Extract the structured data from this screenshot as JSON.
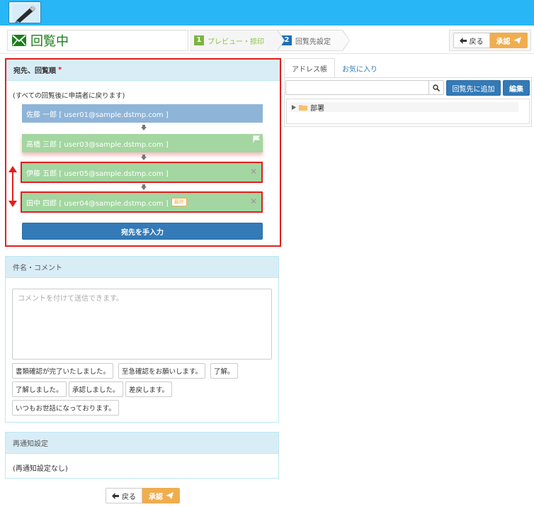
{
  "header": {
    "logo_icon": "pen-icon"
  },
  "title": {
    "icon": "envelope-icon",
    "text": "回覧中"
  },
  "steps": [
    {
      "num": "1",
      "label": "プレビュー・捺印"
    },
    {
      "num": "2",
      "label": "回覧先設定"
    }
  ],
  "actions": {
    "back_label": "戻る",
    "approve_label": "承認"
  },
  "route": {
    "heading": "宛先、回覧順",
    "required_mark": "*",
    "note": "(すべての回覧後に申請者に戻ります)",
    "recipients": [
      {
        "label": "佐藤 一郎 [ user01@sample.dstmp.com ]"
      },
      {
        "label": "高橋 三郎 [ user03@sample.dstmp.com ]"
      },
      {
        "label": "伊藤 五郎 [ user05@sample.dstmp.com ]"
      },
      {
        "label": "田中 四郎 [ user04@sample.dstmp.com ]",
        "badge": "最終"
      }
    ],
    "manual_button": "宛先を手入力"
  },
  "comment": {
    "heading": "件名・コメント",
    "placeholder": "コメントを付けて送信できます。",
    "phrases": [
      "書類確認が完了いたしました。",
      "至急確認をお願いします。",
      "了解。",
      "了解しました。",
      "承認しました。",
      "差戻します。",
      "いつもお世話になっております。"
    ]
  },
  "renotify": {
    "heading": "再通知設定",
    "value": "(再通知設定なし)"
  },
  "addressbook": {
    "tabs": [
      "アドレス帳",
      "お気に入り"
    ],
    "search_placeholder": "",
    "add_button": "回覧先に追加",
    "edit_button": "編集",
    "tree_item": "部署"
  },
  "colors": {
    "topbar": "#29b6f6",
    "primary": "#337ab7",
    "approve": "#f0ad4e",
    "highlight": "#e01f1f",
    "recipient_blue": "#8eb4d8",
    "recipient_green": "#a3d6a0"
  }
}
